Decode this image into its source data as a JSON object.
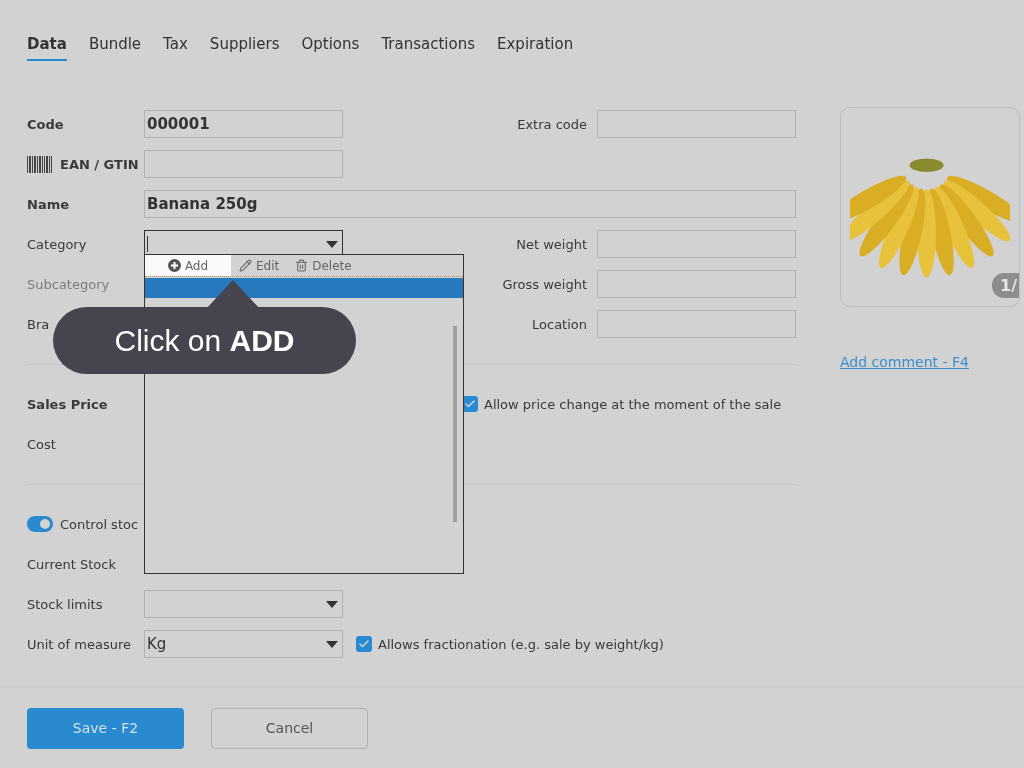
{
  "tabs": [
    {
      "label": "Data",
      "selected": true
    },
    {
      "label": "Bundle",
      "selected": false
    },
    {
      "label": "Tax",
      "selected": false
    },
    {
      "label": "Suppliers",
      "selected": false
    },
    {
      "label": "Options",
      "selected": false
    },
    {
      "label": "Transactions",
      "selected": false
    },
    {
      "label": "Expiration",
      "selected": false
    }
  ],
  "form": {
    "code": {
      "label": "Code",
      "required": true,
      "value": "000001"
    },
    "extra_code": {
      "label": "Extra code"
    },
    "ean": {
      "label": "EAN / GTIN",
      "required": true
    },
    "name": {
      "label": "Name",
      "required": true,
      "value": "Banana 250g"
    },
    "category": {
      "label": "Category",
      "required": false,
      "focused": true
    },
    "net_weight": {
      "label": "Net weight"
    },
    "subcategory": {
      "label": "Subcategory",
      "disabled": true
    },
    "gross_weight": {
      "label": "Gross weight"
    },
    "brand": {
      "label": "Bra",
      "required": false
    },
    "location": {
      "label": "Location"
    },
    "sales_price": {
      "label": "Sales Price",
      "required": true
    },
    "allow_price_change": {
      "label": "Allow price change at the moment of the sale",
      "checked": true
    },
    "cost": {
      "label": "Cost",
      "required": false
    },
    "control_stock": {
      "label": "Control stoc",
      "on": true
    },
    "current_stock": {
      "label": "Current Stock",
      "required": false
    },
    "stock_limits": {
      "label": "Stock limits",
      "required": false
    },
    "unit_of_measure": {
      "label": "Unit of measure",
      "required": false,
      "value": "Kg"
    },
    "allows_fractionation": {
      "label": "Allows fractionation (e.g. sale by weight/kg)",
      "checked": true
    }
  },
  "dropdown": {
    "actions": [
      {
        "label": "Add",
        "selected": true
      },
      {
        "label": "Edit",
        "selected": false
      },
      {
        "label": "Delete",
        "selected": false
      }
    ],
    "items": [
      {
        "selected": true
      }
    ]
  },
  "tooltip": {
    "text": "Click on **ADD**"
  },
  "image": {
    "kind": "picture",
    "badge": "1/"
  },
  "add_comment_link": "Add comment - F4",
  "buttons": [
    {
      "label": "Save - F2",
      "kind": "primary"
    },
    {
      "label": "Cancel",
      "kind": "secondary"
    }
  ]
}
